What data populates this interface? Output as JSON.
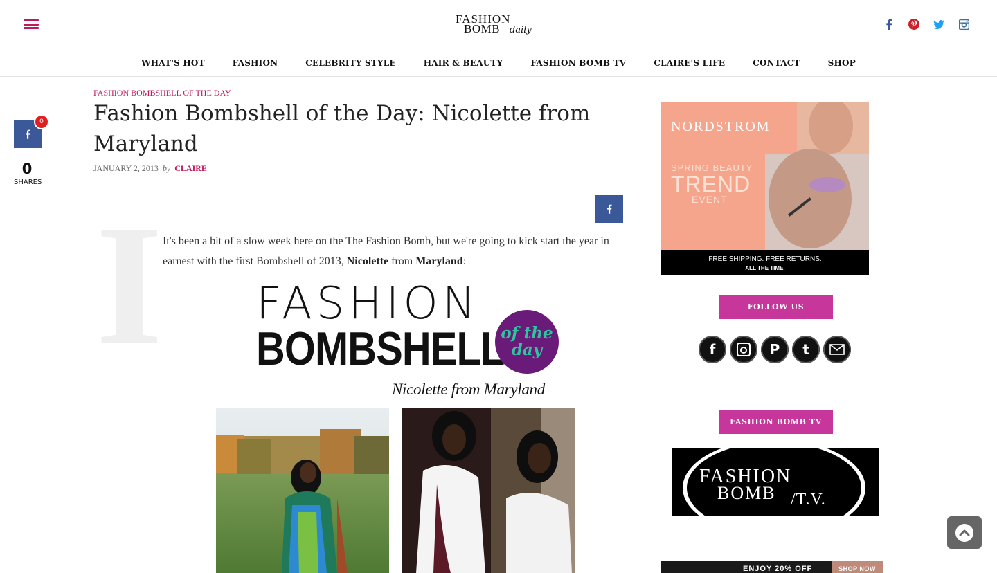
{
  "header": {
    "logo": {
      "line1": "FASHION",
      "line2": "BOMB",
      "line3": "daily"
    },
    "social": [
      {
        "name": "facebook",
        "glyph": "f"
      },
      {
        "name": "pinterest",
        "glyph": "℗"
      },
      {
        "name": "twitter",
        "glyph": "🐦"
      },
      {
        "name": "instagram",
        "glyph": "◘"
      }
    ]
  },
  "nav": {
    "items": [
      "WHAT'S HOT",
      "FASHION",
      "CELEBRITY STYLE",
      "HAIR & BEAUTY",
      "FASHION BOMB TV",
      "CLAIRE'S LIFE",
      "CONTACT",
      "SHOP"
    ]
  },
  "share": {
    "badge": "0",
    "count": "0",
    "label": "SHARES",
    "icon": "facebook-icon"
  },
  "article": {
    "category": "FASHION BOMBSHELL OF THE DAY",
    "title": "Fashion Bombshell of the Day: Nicolette from Maryland",
    "date": "JANUARY 2, 2013",
    "by": "by",
    "author": "CLAIRE",
    "dropcap": "I",
    "intro_start": "It's been a bit of a slow week here on the The Fashion Bomb, but we're going to kick start the year in earnest with the first Bombshell of 2013, ",
    "intro_name": "Nicolette",
    "intro_mid": " from ",
    "intro_place": "Maryland",
    "intro_end": ":",
    "feature": {
      "word1": "FASHION",
      "word2": "BOMBSHELL",
      "circle_line1": "of the",
      "circle_line2": "day",
      "caption": "Nicolette from Maryland",
      "circle_bg": "#6a1b7a",
      "circle_text": "#2ec4a0"
    }
  },
  "sidebar": {
    "nordstrom_ad": {
      "brand": "NORDSTROM",
      "line1": "SPRING BEAUTY",
      "line2": "TREND",
      "line3": "EVENT",
      "footer1": "FREE SHIPPING. FREE RETURNS.",
      "footer2": "ALL THE TIME.",
      "bg": "#f6a58d"
    },
    "follow_title": "FOLLOW US",
    "follow_icons": [
      {
        "name": "facebook",
        "glyph": "f"
      },
      {
        "name": "instagram",
        "glyph": "◙"
      },
      {
        "name": "pinterest",
        "glyph": "P"
      },
      {
        "name": "twitter",
        "glyph": "t"
      },
      {
        "name": "email",
        "glyph": "✉"
      }
    ],
    "tv_title": "FASHION BOMB TV",
    "tv_banner": {
      "line1": "FASHION",
      "line2": "BOMB",
      "line3": "/T.V."
    },
    "bottom_ad": {
      "text": "ENJOY 20% OFF",
      "cta": "SHOP NOW"
    }
  },
  "colors": {
    "accent": "#c2185b",
    "pill": "#c7369a",
    "facebook": "#3b5998"
  }
}
